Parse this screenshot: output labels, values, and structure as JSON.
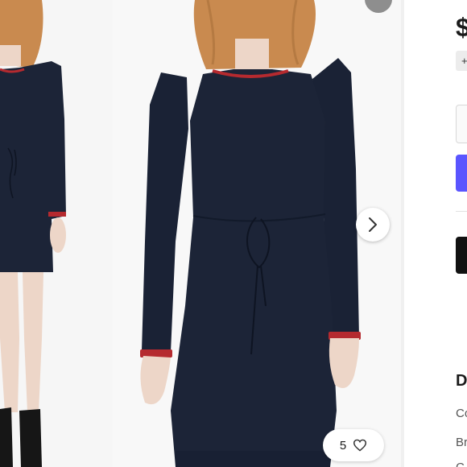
{
  "gallery": {
    "like_count": "5",
    "icons": {
      "next": "chevron-right-icon",
      "like": "heart-icon"
    }
  },
  "sidebar": {
    "price": "$",
    "size_chip": "+",
    "description_heading": "D",
    "rows": [
      "Co",
      "Br",
      "C"
    ]
  },
  "colors": {
    "dress": "#1c2437",
    "trim": "#b52a2f",
    "accent": "#5a55ff",
    "skin": "#edd6c8",
    "hair": "#c98a4f"
  }
}
